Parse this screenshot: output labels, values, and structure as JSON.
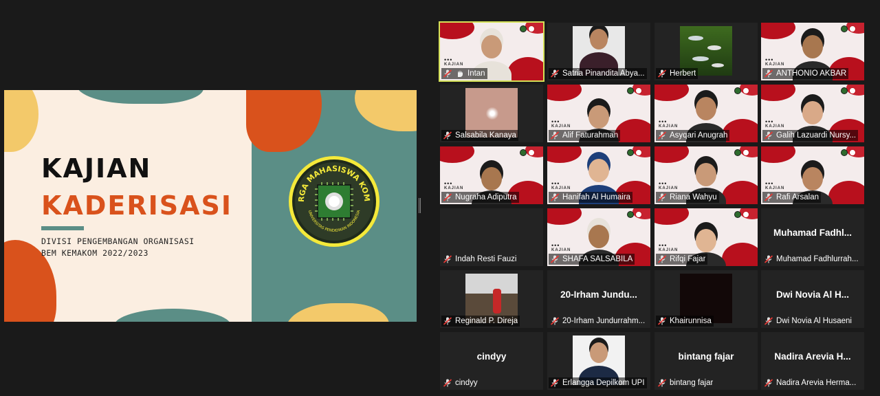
{
  "slide": {
    "title_line1": "KAJIAN",
    "title_line2": "KADERISASI",
    "subtitle_line1": "DIVISI PENGEMBANGAN ORGANISASI",
    "subtitle_line2": "BEM KEMAKOM 2022/2023",
    "logo_top_text": "KELUARGA MAHASISWA KOMPUTER",
    "logo_bottom_text": "UNIVERSITAS PENDIDIKAN INDONESIA"
  },
  "colors": {
    "accent_active": "#d4e157",
    "brand_red": "#b8101d",
    "teal": "#5b8e86",
    "orange": "#d9521c"
  },
  "participants": [
    {
      "name": "Intan",
      "kind": "red",
      "hand_icon": true,
      "active": true
    },
    {
      "name": "Satria Pinandita Abya...",
      "kind": "photo"
    },
    {
      "name": "Herbert",
      "kind": "fish"
    },
    {
      "name": "ANTHONIO AKBAR",
      "kind": "red"
    },
    {
      "name": "Salsabila Kanaya",
      "kind": "pink"
    },
    {
      "name": "Alif Faturahman",
      "kind": "red"
    },
    {
      "name": "Asyqari Anugrah",
      "kind": "red"
    },
    {
      "name": "Galih Lazuardi Nursy...",
      "kind": "red"
    },
    {
      "name": "Nugraha Adiputra",
      "kind": "red"
    },
    {
      "name": "Hanifah Al Humaira",
      "kind": "red"
    },
    {
      "name": "Riana Wahyu",
      "kind": "red"
    },
    {
      "name": "Rafi Arsalan",
      "kind": "red"
    },
    {
      "name": "Indah Resti Fauzi",
      "kind": "empty"
    },
    {
      "name": "SHAFA SALSABILA",
      "kind": "red"
    },
    {
      "name": "Rifqi Fajar",
      "kind": "red"
    },
    {
      "name": "Muhamad Fadhlurrah...",
      "kind": "text",
      "display": "Muhamad  Fadhl..."
    },
    {
      "name": "Reginald P. Direja",
      "kind": "outdoor"
    },
    {
      "name": "20-Irham Jundurrahm...",
      "kind": "text",
      "display": "20-Irham  Jundu..."
    },
    {
      "name": "Khairunnisa",
      "kind": "dark"
    },
    {
      "name": "Dwi Novia Al Husaeni",
      "kind": "text",
      "display": "Dwi Novia Al H..."
    },
    {
      "name": "cindyy",
      "kind": "text",
      "display": "cindyy"
    },
    {
      "name": "Erlangga Depilkom UPI",
      "kind": "suit"
    },
    {
      "name": "bintang fajar",
      "kind": "text",
      "display": "bintang fajar"
    },
    {
      "name": "Nadira Arevia Herma...",
      "kind": "text",
      "display": "Nadira Arevia H..."
    }
  ]
}
